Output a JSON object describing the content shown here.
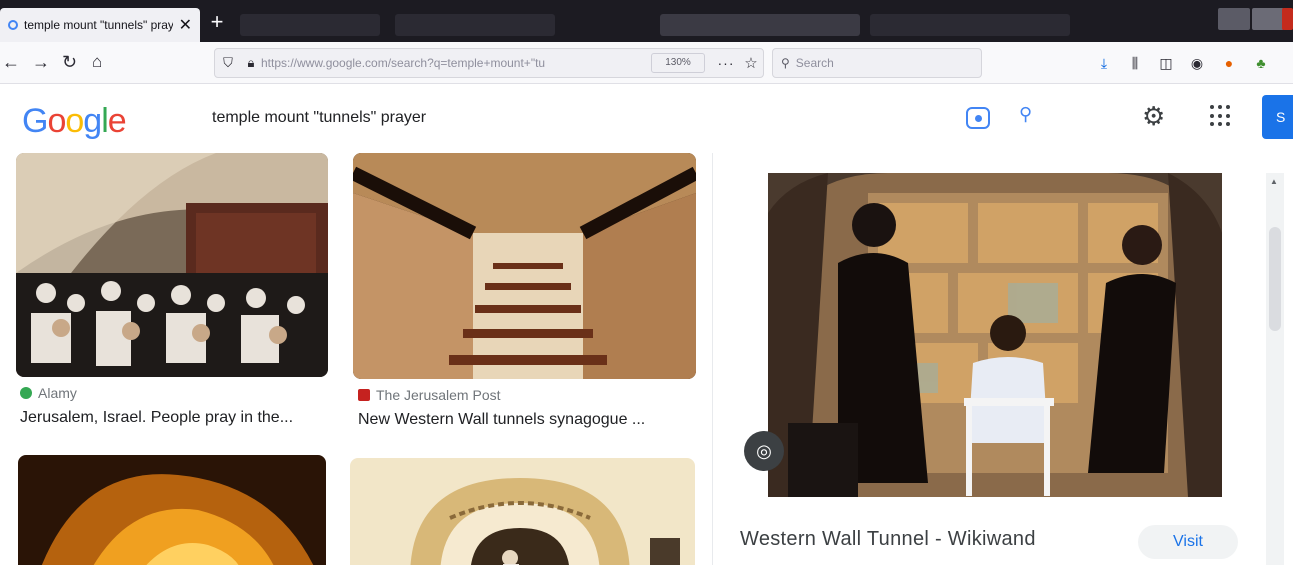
{
  "browser": {
    "tab_title": "temple mount \"tunnels\" prayer",
    "tab_close": "✕",
    "new_tab": "+",
    "url": "https://www.google.com/search?q=temple+mount+\"tu",
    "zoom": "130%",
    "more": "···",
    "search_placeholder": "Search"
  },
  "google": {
    "logo_letters": [
      "G",
      "o",
      "o",
      "g",
      "l",
      "e"
    ],
    "logo_colors": [
      "#4285f4",
      "#ea4335",
      "#fbbc05",
      "#4285f4",
      "#34a853",
      "#ea4335"
    ],
    "query": "temple mount \"tunnels\" prayer",
    "signin_initial": "S"
  },
  "results": [
    {
      "source": "Alamy",
      "source_color": "#34a853",
      "title": "Jerusalem, Israel. People pray in the..."
    },
    {
      "source": "The Jerusalem Post",
      "source_color": "#c5221f",
      "title": "New Western Wall tunnels synagogue ..."
    }
  ],
  "preview": {
    "title": "Western Wall Tunnel - Wikiwand",
    "visit_label": "Visit"
  }
}
